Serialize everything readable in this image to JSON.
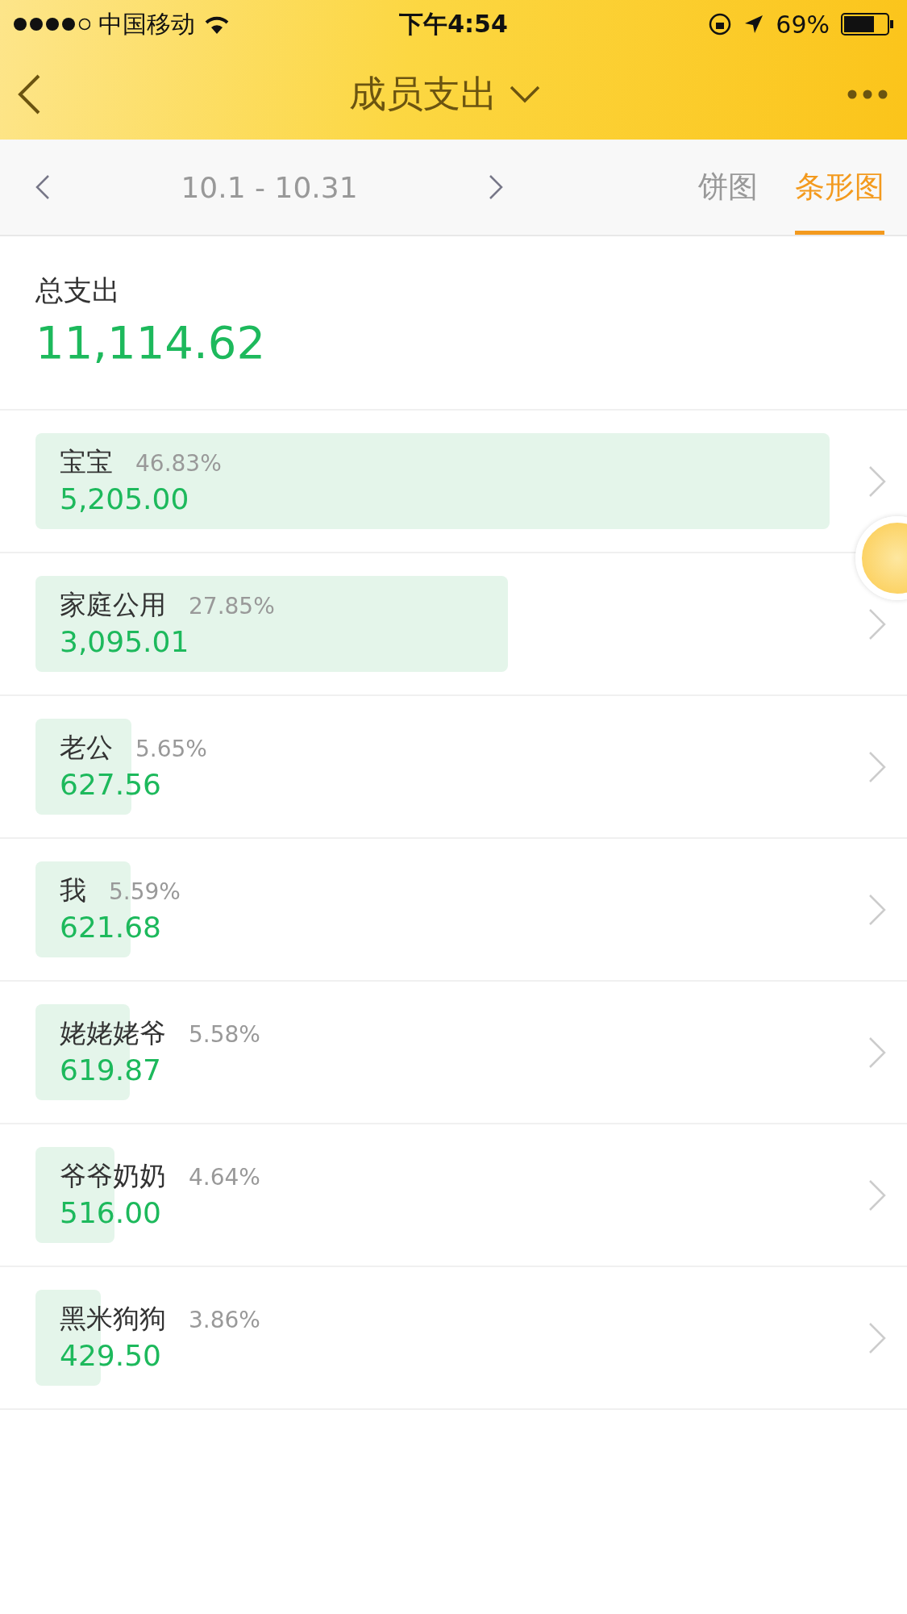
{
  "status_bar": {
    "carrier": "中国移动",
    "time": "下午4:54",
    "battery": "69%"
  },
  "nav": {
    "title": "成员支出"
  },
  "period": {
    "range": "10.1 - 10.31"
  },
  "tabs": [
    {
      "label": "饼图",
      "selected": false
    },
    {
      "label": "条形图",
      "selected": true
    }
  ],
  "total": {
    "label": "总支出",
    "amount": "11,114.62"
  },
  "members": [
    {
      "name": "宝宝",
      "percent": "46.83%",
      "amount": "5,205.00"
    },
    {
      "name": "家庭公用",
      "percent": "27.85%",
      "amount": "3,095.01"
    },
    {
      "name": "老公",
      "percent": "5.65%",
      "amount": "627.56"
    },
    {
      "name": "我",
      "percent": "5.59%",
      "amount": "621.68"
    },
    {
      "name": "姥姥姥爷",
      "percent": "5.58%",
      "amount": "619.87"
    },
    {
      "name": "爷爷奶奶",
      "percent": "4.64%",
      "amount": "516.00"
    },
    {
      "name": "黑米狗狗",
      "percent": "3.86%",
      "amount": "429.50"
    }
  ]
}
